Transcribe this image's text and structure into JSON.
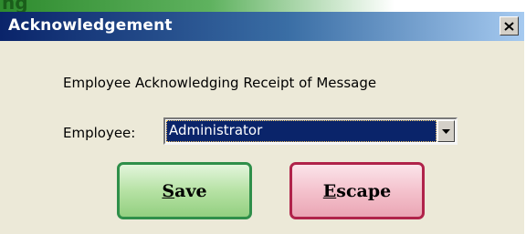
{
  "background_text": "ng",
  "window": {
    "title": "Acknowledgement",
    "close_symbol": "×"
  },
  "dialog": {
    "heading": "Employee Acknowledging Receipt of Message",
    "employee_label": "Employee:",
    "employee_selected": "Administrator"
  },
  "buttons": {
    "save": {
      "mnemonic": "S",
      "rest": "ave"
    },
    "escape": {
      "mnemonic": "E",
      "rest": "scape"
    }
  },
  "colors": {
    "titlebar_start": "#0a246a",
    "titlebar_end": "#a6caf0",
    "save_border": "#2f8f4a",
    "escape_border": "#b0234a",
    "selection": "#0a246a"
  },
  "icons": {
    "close": "close-icon",
    "dropdown": "chevron-down-icon"
  }
}
